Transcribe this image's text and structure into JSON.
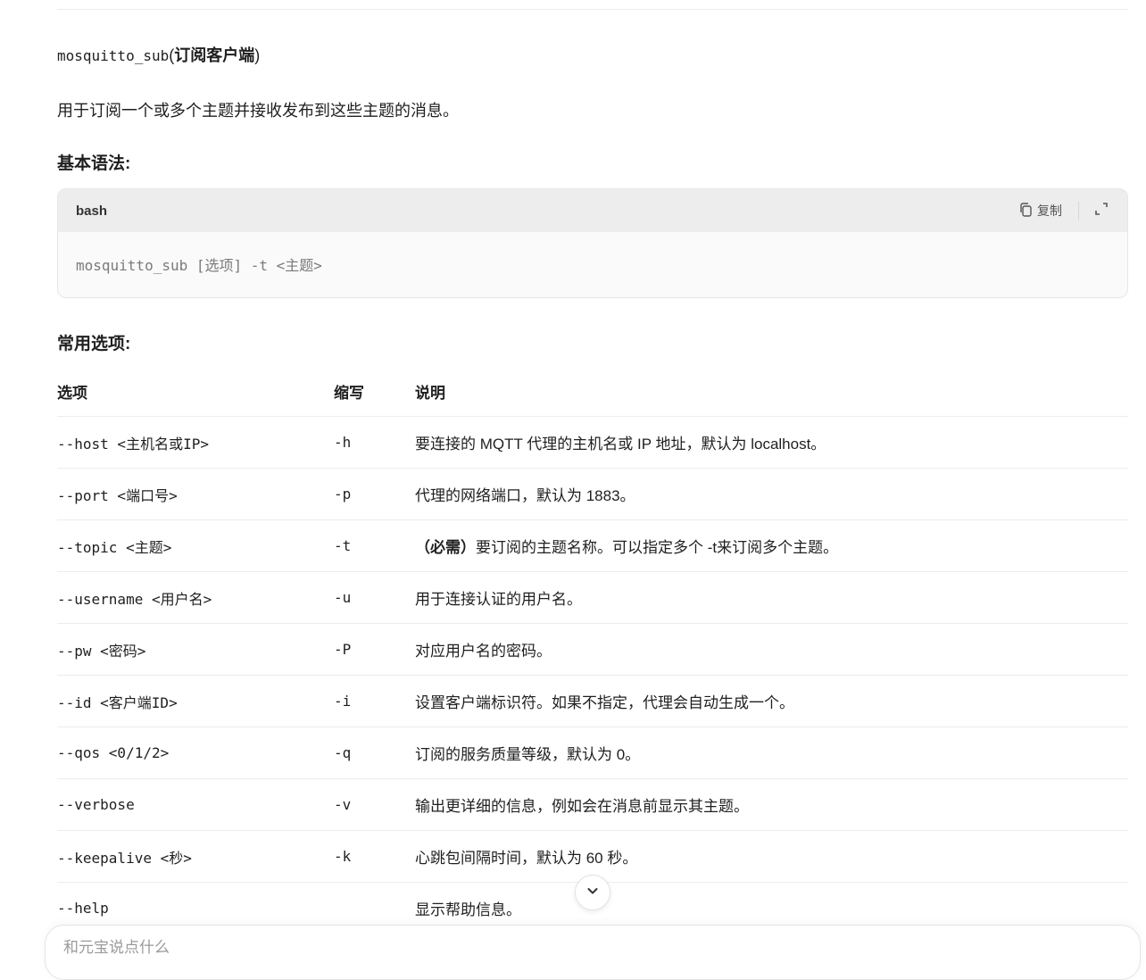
{
  "section": {
    "cmd": "mosquitto_sub",
    "open_paren": "(",
    "label": "订阅客户端",
    "close_paren": ")"
  },
  "intro": "用于订阅一个或多个主题并接收发布到这些主题的消息。",
  "syntax_heading": "基本语法:",
  "code": {
    "lang": "bash",
    "copy_label": "复制",
    "line": "mosquitto_sub [选项] -t <主题>"
  },
  "options_heading": "常用选项:",
  "table": {
    "headers": [
      "选项",
      "缩写",
      "说明"
    ],
    "rows": [
      {
        "opt": "--host <主机名或IP>",
        "abbr": "-h",
        "desc": "要连接的 MQTT 代理的主机名或 IP 地址，默认为 localhost。"
      },
      {
        "opt": "--port <端口号>",
        "abbr": "-p",
        "desc": "代理的网络端口，默认为 1883。"
      },
      {
        "opt": "--topic <主题>",
        "abbr": "-t",
        "req": "（必需）",
        "desc": "要订阅的主题名称。可以指定多个 -t来订阅多个主题。"
      },
      {
        "opt": "--username <用户名>",
        "abbr": "-u",
        "desc": "用于连接认证的用户名。"
      },
      {
        "opt": "--pw <密码>",
        "abbr": "-P",
        "desc": "对应用户名的密码。"
      },
      {
        "opt": "--id <客户端ID>",
        "abbr": "-i",
        "desc": "设置客户端标识符。如果不指定，代理会自动生成一个。"
      },
      {
        "opt": "--qos <0/1/2>",
        "abbr": "-q",
        "desc": "订阅的服务质量等级，默认为 0。"
      },
      {
        "opt": "--verbose",
        "abbr": "-v",
        "desc": "输出更详细的信息，例如会在消息前显示其主题。"
      },
      {
        "opt": "--keepalive <秒>",
        "abbr": "-k",
        "desc": "心跳包间隔时间，默认为 60 秒。"
      },
      {
        "opt": "--help",
        "abbr": "",
        "desc": "显示帮助信息。"
      }
    ]
  },
  "input": {
    "placeholder": "和元宝说点什么"
  }
}
